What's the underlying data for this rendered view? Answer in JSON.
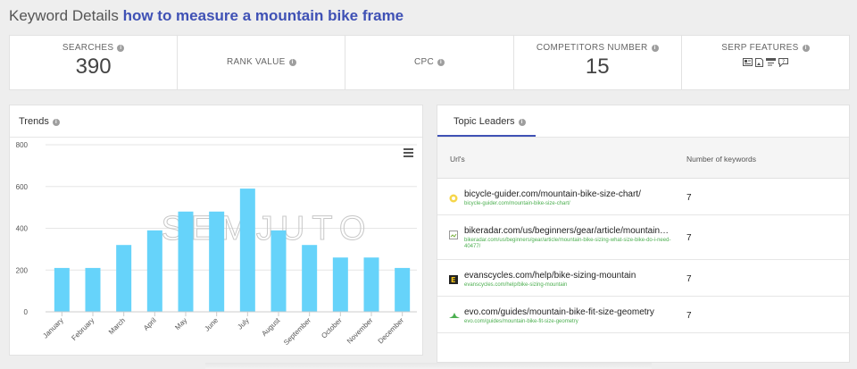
{
  "header": {
    "prefix": "Keyword Details",
    "keyword": "how to measure a mountain bike frame"
  },
  "stats": [
    {
      "label": "SEARCHES",
      "value": "390"
    },
    {
      "label": "RANK VALUE",
      "value": ""
    },
    {
      "label": "CPC",
      "value": ""
    },
    {
      "label": "COMPETITORS NUMBER",
      "value": "15"
    },
    {
      "label": "SERP FEATURES",
      "icons": [
        "featured-snippet-icon",
        "image-pack-icon",
        "sitelinks-icon",
        "people-also-ask-icon"
      ]
    }
  ],
  "trends": {
    "title": "Trends",
    "watermark": "SEMJUTO"
  },
  "chart_data": {
    "type": "bar",
    "categories": [
      "January",
      "February",
      "March",
      "April",
      "May",
      "June",
      "July",
      "August",
      "September",
      "October",
      "November",
      "December"
    ],
    "values": [
      210,
      210,
      320,
      390,
      480,
      480,
      590,
      390,
      320,
      260,
      260,
      210
    ],
    "ylim": [
      0,
      800
    ],
    "yticks": [
      "0",
      "200",
      "400",
      "600",
      "800"
    ],
    "color": "#66d3fa",
    "grid": true
  },
  "leaders": {
    "tab": "Topic Leaders",
    "col_url": "Url's",
    "col_keywords": "Number of keywords",
    "rows": [
      {
        "url": "bicycle-guider.com/mountain-bike-size-chart/",
        "sub": "bicycle-guider.com/mountain-bike-size-chart/",
        "count": "7",
        "icon": "bicycle-guider-favicon"
      },
      {
        "url": "bikeradar.com/us/beginners/gear/article/mountain-bike-sizing-what-size-bike-do-i-need-40477/",
        "sub": "bikeradar.com/us/beginners/gear/article/mountain-bike-sizing-what-size-bike-do-i-need-40477/",
        "count": "7",
        "icon": "broken-image-icon"
      },
      {
        "url": "evanscycles.com/help/bike-sizing-mountain",
        "sub": "evanscycles.com/help/bike-sizing-mountain",
        "count": "7",
        "icon": "evanscycles-favicon"
      },
      {
        "url": "evo.com/guides/mountain-bike-fit-size-geometry",
        "sub": "evo.com/guides/mountain-bike-fit-size-geometry",
        "count": "7",
        "icon": "evo-favicon"
      }
    ]
  }
}
